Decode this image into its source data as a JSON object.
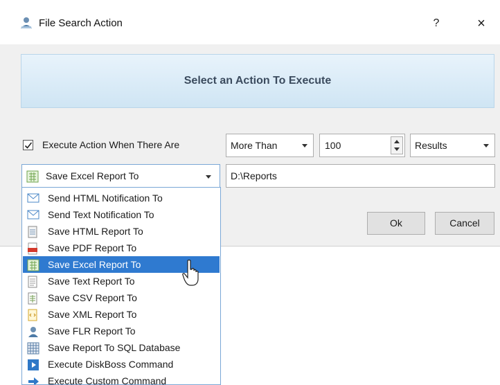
{
  "window": {
    "title": "File Search Action",
    "help": "?",
    "close": "×"
  },
  "banner": {
    "text": "Select an Action To Execute"
  },
  "condition": {
    "checkbox_label": "Execute Action When There Are",
    "checked": true,
    "comparison": "More Than",
    "count": "100",
    "unit": "Results"
  },
  "action": {
    "selected": "Save Excel Report To",
    "path": "D:\\Reports"
  },
  "buttons": {
    "ok": "Ok",
    "cancel": "Cancel"
  },
  "dropdown": {
    "items": [
      {
        "label": "Send HTML Notification To",
        "icon": "envelope-icon"
      },
      {
        "label": "Send Text Notification To",
        "icon": "envelope-icon"
      },
      {
        "label": "Save HTML Report To",
        "icon": "html-file-icon"
      },
      {
        "label": "Save PDF Report To",
        "icon": "pdf-file-icon"
      },
      {
        "label": "Save Excel Report To",
        "icon": "excel-file-icon"
      },
      {
        "label": "Save Text Report To",
        "icon": "text-file-icon"
      },
      {
        "label": "Save CSV Report To",
        "icon": "csv-file-icon"
      },
      {
        "label": "Save XML Report To",
        "icon": "xml-file-icon"
      },
      {
        "label": "Save FLR Report To",
        "icon": "flr-file-icon"
      },
      {
        "label": "Save Report To SQL Database",
        "icon": "database-grid-icon"
      },
      {
        "label": "Execute DiskBoss Command",
        "icon": "play-icon"
      },
      {
        "label": "Execute Custom Command",
        "icon": "arrow-right-icon"
      }
    ],
    "selected_index": 4
  },
  "colors": {
    "selection": "#2f7ad0",
    "banner_text": "#3b4b5e"
  }
}
